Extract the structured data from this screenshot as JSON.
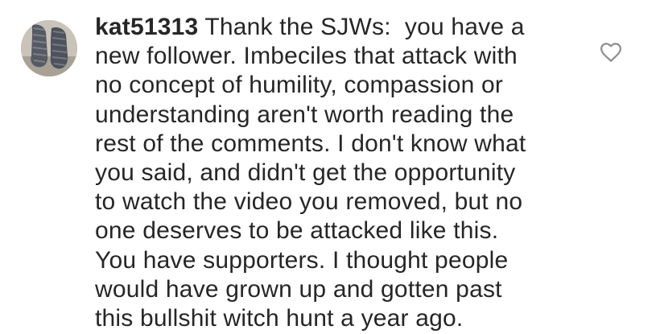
{
  "comment": {
    "username": "kat51313",
    "first_line_text": " Thank the SJWs:  you have a",
    "lines": [
      "new follower. Imbeciles that attack with",
      "no concept of humility, compassion or",
      "understanding aren't worth reading the",
      "rest of the comments. I don't know what",
      "you said, and didn't get the opportunity",
      "to watch the video you removed, but no",
      "one deserves to be attacked like this.",
      "You have supporters. I thought people",
      "would have grown up and gotten past",
      "this bullshit witch hunt a year ago."
    ]
  },
  "icons": {
    "like": "heart-outline-icon",
    "avatar": "user-avatar"
  },
  "colors": {
    "text": "#262626",
    "icon_stroke": "#8e8e8e",
    "background": "#ffffff"
  }
}
